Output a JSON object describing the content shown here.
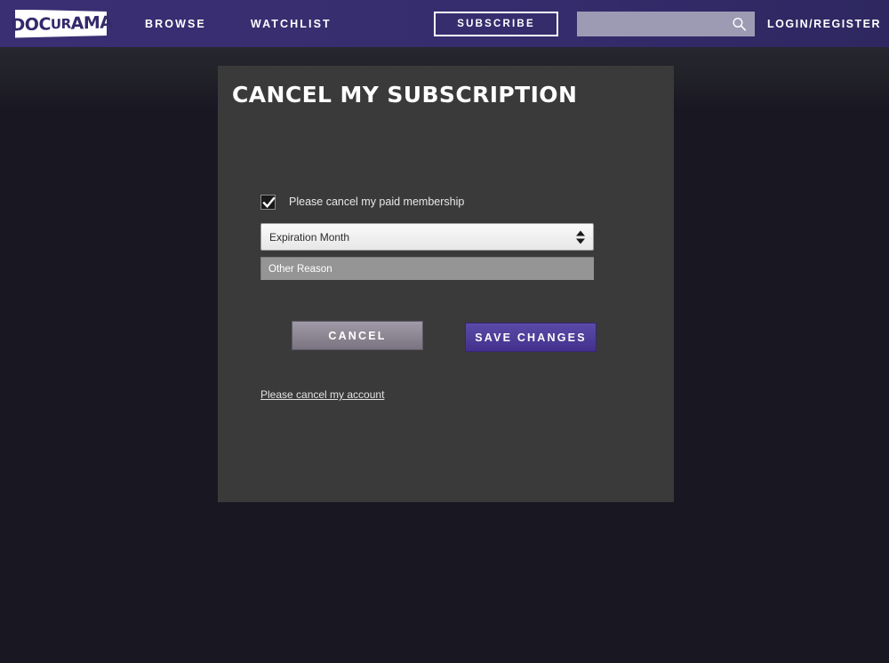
{
  "header": {
    "logo": {
      "name": "docurama-logo",
      "text_main": "DOC",
      "text_mid": "UR",
      "text_end": "AMA",
      "full_text": "DOCURAMA"
    },
    "nav": [
      {
        "label": "BROWSE",
        "name": "nav-browse"
      },
      {
        "label": "WATCHLIST",
        "name": "nav-watchlist"
      }
    ],
    "subscribe_label": "SUBSCRIBE",
    "search": {
      "value": "",
      "placeholder": "",
      "icon": "search-icon"
    },
    "login_label": "LOGIN/REGISTER",
    "colors": {
      "bar_left": "#3a2f73",
      "bar_right": "#2e2760",
      "search_field": "#9d9bb4"
    }
  },
  "panel": {
    "title": "CANCEL MY SUBSCRIPTION",
    "checkbox": {
      "label": "Please cancel my paid membership",
      "checked": true
    },
    "reason_select": {
      "selected": "Expiration Month",
      "options": [
        "Expiration Month"
      ]
    },
    "other_reason": {
      "value": "",
      "placeholder": "Other Reason"
    },
    "buttons": {
      "cancel_label": "CANCEL",
      "save_label": "SAVE CHANGES"
    },
    "cancel_account_link": "Please cancel my account",
    "colors": {
      "panel_bg": "#3a3a3a",
      "page_bg": "#191822",
      "save_button": "#4e3f99",
      "cancel_button": "#8e8894"
    }
  }
}
